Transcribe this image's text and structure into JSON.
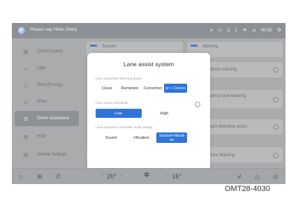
{
  "status_bar": {
    "assistant_text": "Please say Hello Chery",
    "icons": [
      "antenna-icon",
      "screen-icon",
      "media-icon",
      "bluetooth-icon",
      "wifi-icon",
      "signal-icon"
    ],
    "time": "00:00"
  },
  "sidebar": {
    "items": [
      {
        "label": "Quick Control",
        "icon": "quick-control-icon",
        "active": false
      },
      {
        "label": "Light",
        "icon": "light-icon",
        "active": false
      },
      {
        "label": "Seat (Energy)",
        "icon": "seat-icon",
        "active": false
      },
      {
        "label": "Drive",
        "icon": "drive-icon",
        "active": false
      },
      {
        "label": "Driver Assistance",
        "icon": "driver-assistance-icon",
        "active": true
      },
      {
        "label": "HUD",
        "icon": "hud-icon",
        "active": false
      },
      {
        "label": "Vehicle Settings",
        "icon": "vehicle-settings-icon",
        "active": false
      }
    ]
  },
  "background_cards": [
    {
      "label": "System"
    },
    {
      "label": "Warning"
    },
    {
      "label": "e collision warning"
    },
    {
      "label": "mergency lane keeping\nst"
    },
    {
      "label": "ind spot detection assist"
    },
    {
      "label": "eparture Warning"
    }
  ],
  "dialog": {
    "title": "Lane assist system",
    "mode": {
      "label": "Lane Departure Warning Mode",
      "options": [
        "Close",
        "Reminder",
        "Correction",
        "or + Correc"
      ],
      "selected": 3
    },
    "sensitivity": {
      "label": "Lane assist sensitivity",
      "options": [
        "Low",
        "High"
      ],
      "selected": 0
    },
    "reminder": {
      "label": "Lane departure reminder mode setting",
      "options": [
        "Sound",
        "Vibration",
        "Sound+Vibrati on"
      ],
      "selected": 2
    }
  },
  "bottom_bar": {
    "left_temp": "20°",
    "right_temp": "16°",
    "left_arrow": "‹",
    "right_arrow": "›"
  },
  "figure_code": "OMT28-4030"
}
